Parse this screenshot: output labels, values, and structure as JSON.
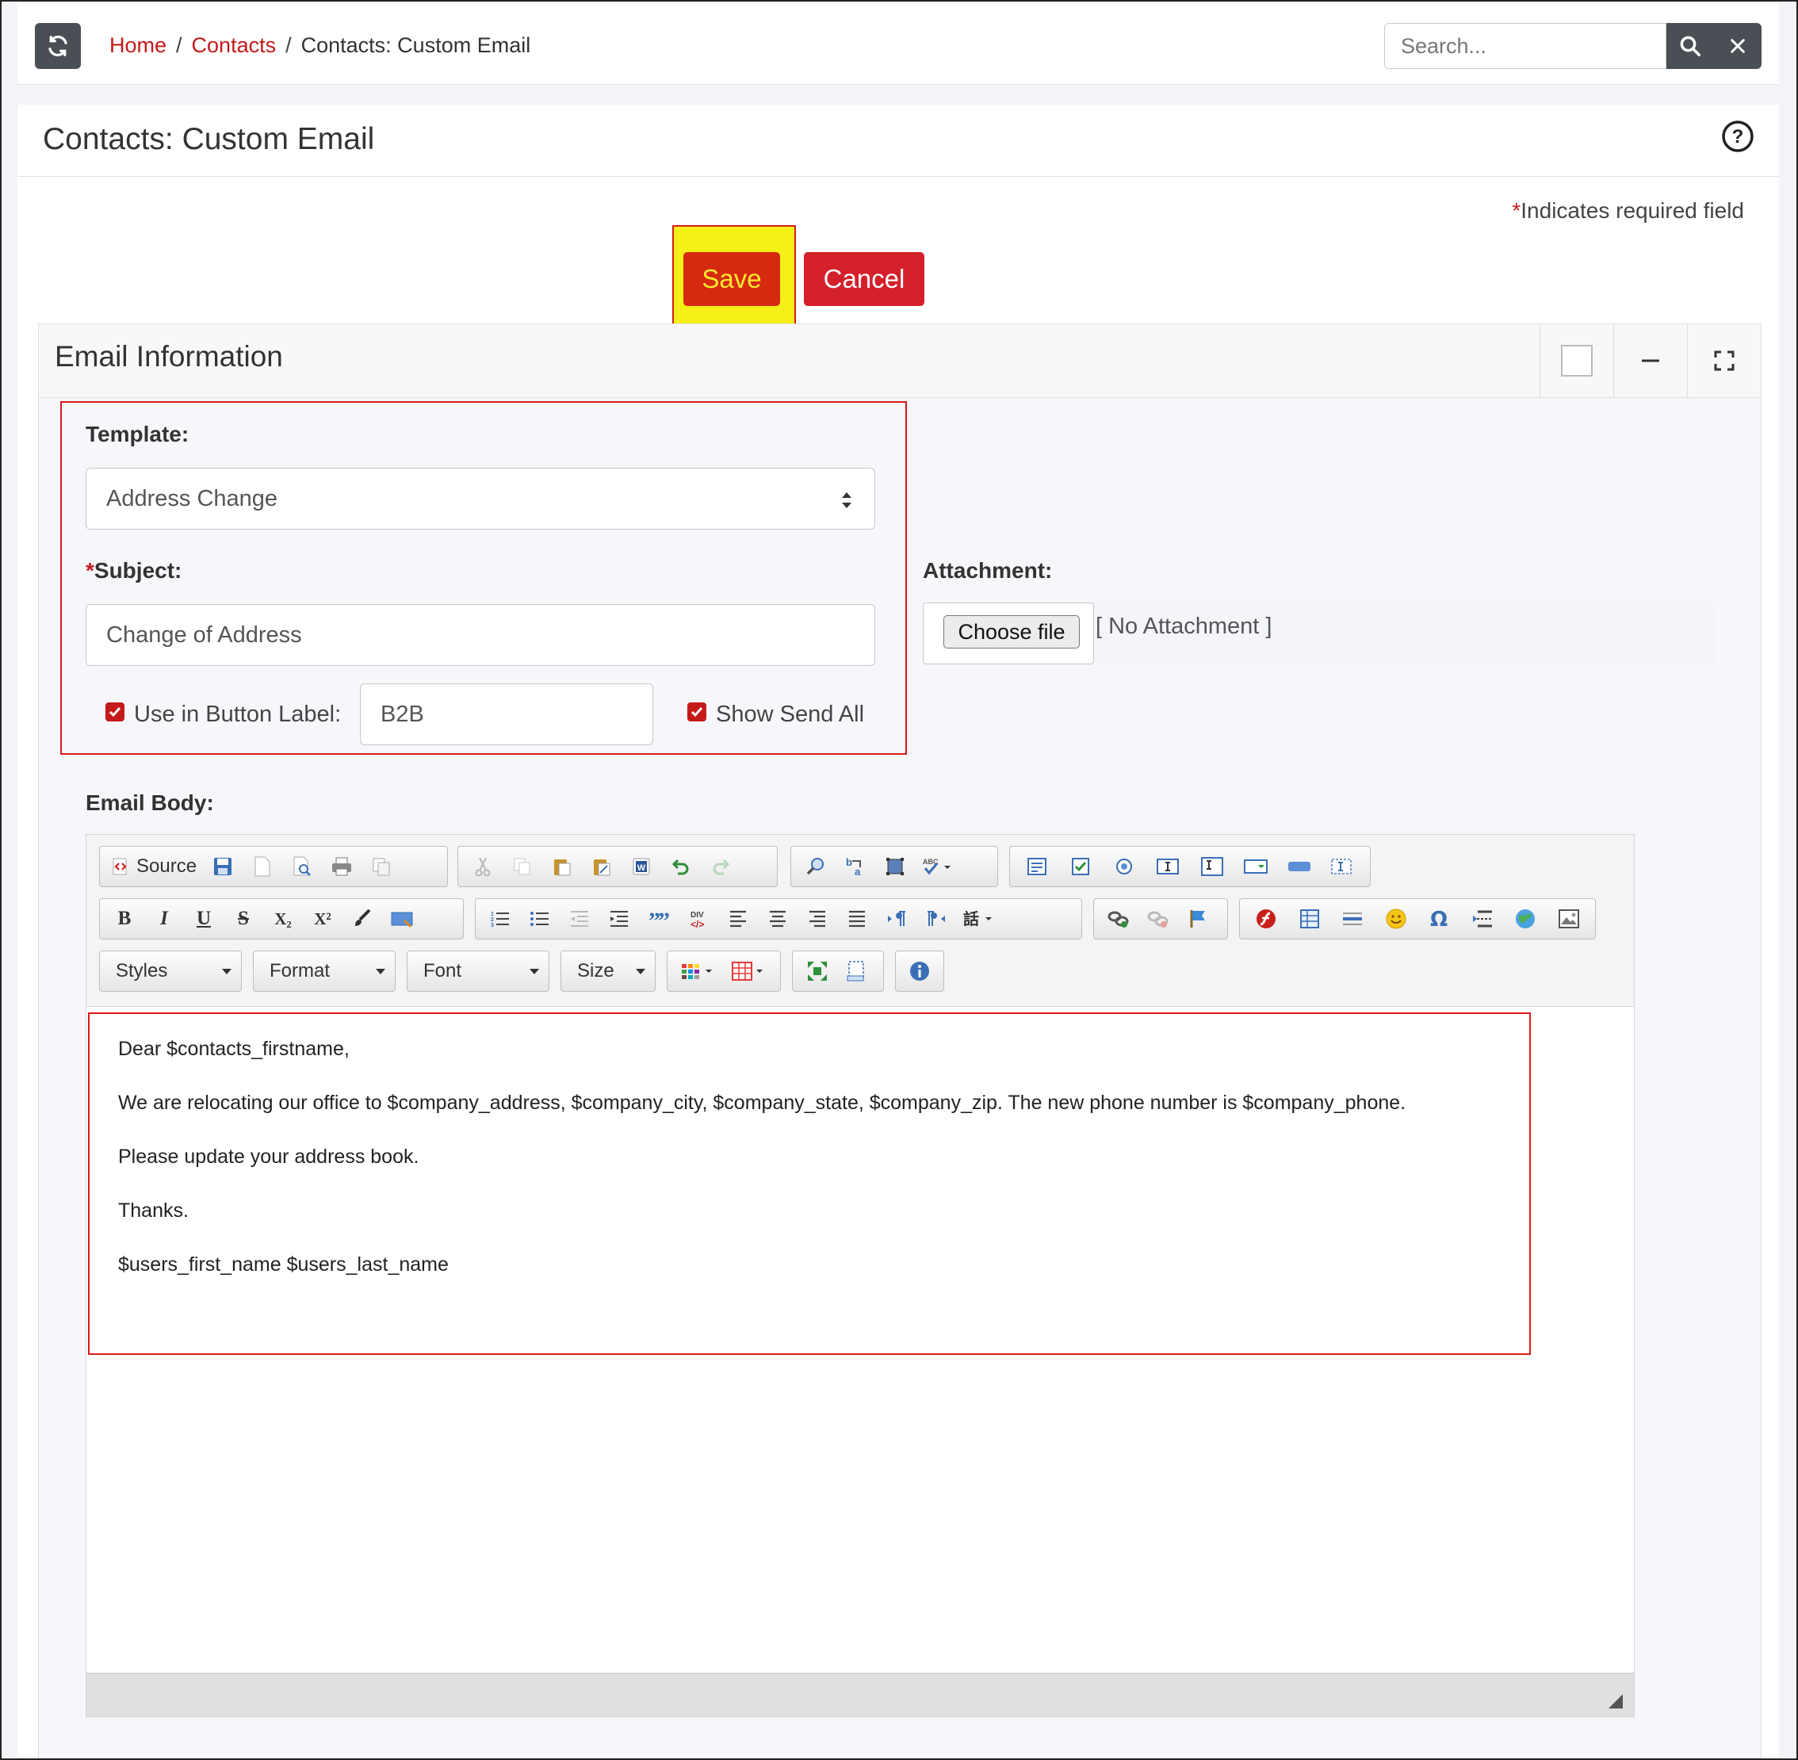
{
  "breadcrumb": {
    "home": "Home",
    "contacts": "Contacts",
    "current": "Contacts: Custom Email",
    "separator": "/"
  },
  "search": {
    "placeholder": "Search..."
  },
  "page": {
    "title": "Contacts: Custom Email",
    "required_star": "*",
    "required_note": "Indicates required field"
  },
  "actions": {
    "save": "Save",
    "cancel": "Cancel"
  },
  "card": {
    "title": "Email Information"
  },
  "form": {
    "template_label": "Template:",
    "template_value": "Address Change",
    "subject_star": "*",
    "subject_label": "Subject:",
    "subject_value": "Change of Address",
    "use_in_button_label": "Use in Button Label:",
    "use_in_button_checked": true,
    "button_label_value": "B2B",
    "show_send_all": "Show Send All",
    "show_send_all_checked": true,
    "attachment_label": "Attachment:",
    "choose_file": "Choose file",
    "no_attachment": "[ No Attachment ]",
    "email_body_label": "Email Body:"
  },
  "editor": {
    "source_label": "Source",
    "bold": "B",
    "italic": "I",
    "underline": "U",
    "strike": "S",
    "subscript": "X₂",
    "superscript": "X²",
    "combos": {
      "styles": "Styles",
      "format": "Format",
      "font": "Font",
      "size": "Size"
    },
    "body": [
      "Dear $contacts_firstname,",
      "We are relocating our office to $company_address, $company_city, $company_state, $company_zip. The new phone number is $company_phone.",
      "Please update your address book.",
      "Thanks.",
      "$users_first_name $users_last_name"
    ]
  },
  "colors": {
    "brand_red": "#c41a1a",
    "save_bg": "#d62a10",
    "save_text": "#ffe92e",
    "highlight": "#f4f018",
    "dark_button": "#4a4f55"
  }
}
